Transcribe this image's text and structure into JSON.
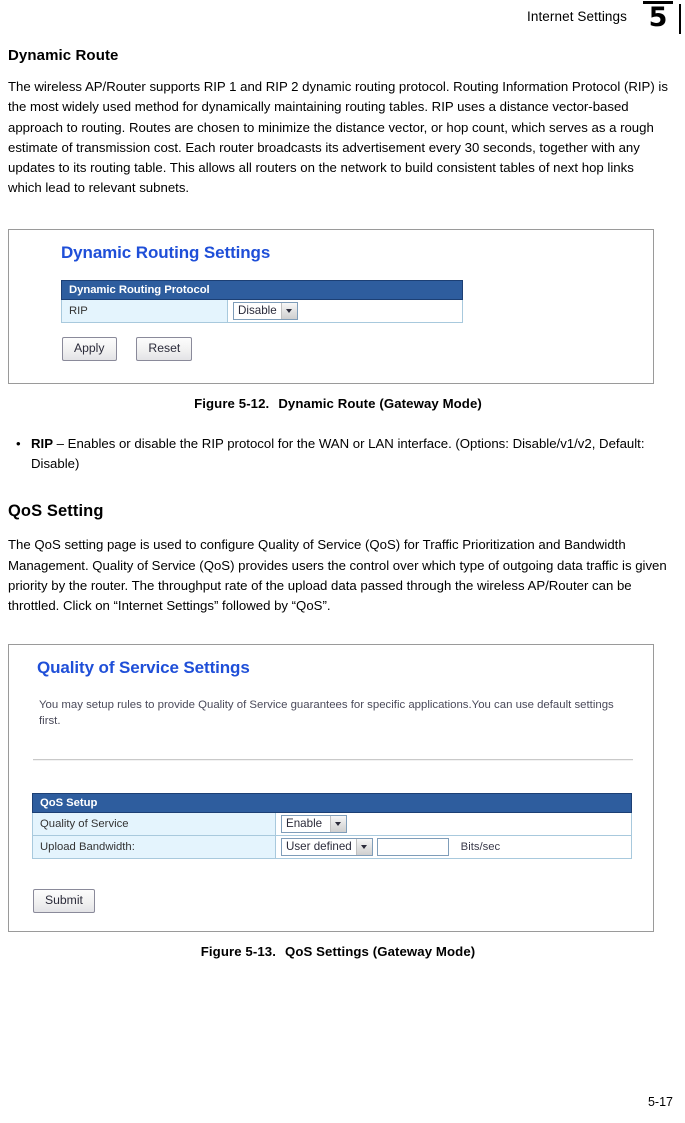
{
  "header": {
    "title": "Internet Settings",
    "chapter_number": "5"
  },
  "sections": [
    {
      "heading": "Dynamic Route",
      "paragraph": "The wireless AP/Router supports RIP 1 and RIP 2 dynamic routing protocol. Routing Information Protocol (RIP) is the most widely used method for dynamically maintaining routing tables. RIP uses a distance vector-based approach to routing. Routes are chosen to minimize the distance vector, or hop count, which serves as a rough estimate of transmission cost. Each router broadcasts its advertisement every 30 seconds, together with any updates to its routing table. This allows all routers on the network to build consistent tables of next hop links which lead to relevant subnets."
    },
    {
      "heading": "QoS Setting",
      "paragraph": "The QoS setting page is used to configure Quality of Service (QoS) for Traffic Prioritization and Bandwidth Management. Quality of Service (QoS) provides users the control over which type of outgoing data traffic is given priority by the router. The throughput rate of the upload data passed through the wireless AP/Router can be throttled. Click on “Internet Settings” followed by “QoS”."
    }
  ],
  "figure_dynamic_route": {
    "screenshot": {
      "title": "Dynamic Routing Settings",
      "table_header": "Dynamic Routing Protocol",
      "row_label": "RIP",
      "row_select_value": "Disable",
      "apply_label": "Apply",
      "reset_label": "Reset"
    },
    "caption_number": "Figure 5-12.",
    "caption_text": "Dynamic Route (Gateway Mode)"
  },
  "bullet_items": [
    {
      "bullet": "•",
      "term": "RIP",
      "description": " – Enables or disable the RIP protocol for the WAN or LAN interface. (Options: Disable/v1/v2, Default: Disable)"
    }
  ],
  "figure_qos": {
    "screenshot": {
      "title": "Quality of Service Settings",
      "description": "You may setup rules to provide Quality of Service guarantees for specific applications.You can use default settings first.",
      "table_header": "QoS Setup",
      "rows": [
        {
          "label": "Quality of Service",
          "select_value": "Enable",
          "input_value": "",
          "unit": ""
        },
        {
          "label": "Upload Bandwidth:",
          "select_value": "User defined",
          "input_value": "",
          "unit": "Bits/sec"
        }
      ],
      "submit_label": "Submit"
    },
    "caption_number": "Figure 5-13.",
    "caption_text": "QoS Settings (Gateway Mode)"
  },
  "footer": {
    "page_number": "5-17"
  },
  "colors": {
    "table_header_blue": "#2e5d9e",
    "row_label_blue": "#e4f4fd",
    "screenshot_title_blue": "#1f4fd8"
  }
}
